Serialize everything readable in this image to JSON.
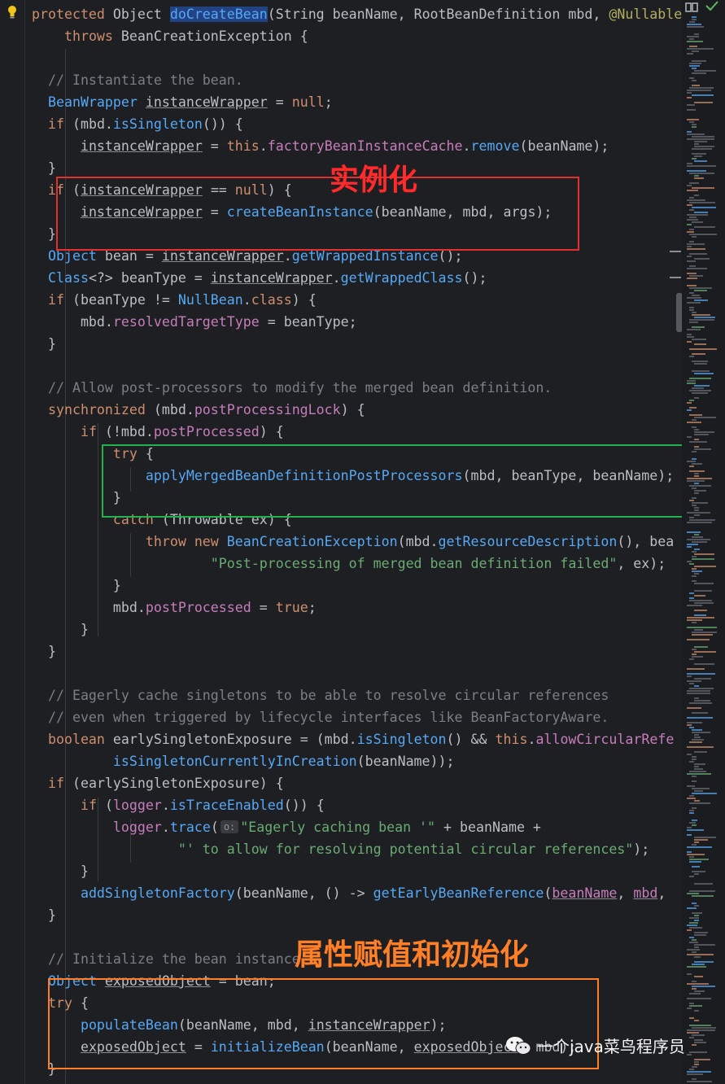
{
  "editor": {
    "lines": [
      [
        [
          "kw",
          "protected "
        ],
        [
          "ty",
          "Object "
        ],
        [
          "fn hl",
          "doCreateBean"
        ],
        [
          "ty",
          "("
        ],
        [
          "ty",
          "String beanName, "
        ],
        [
          "ty",
          "RootBeanDefinition mbd, "
        ],
        [
          "an",
          "@Nullable"
        ]
      ],
      [
        [
          "ty",
          "    "
        ],
        [
          "kw",
          "throws "
        ],
        [
          "ty",
          "BeanCreationException {"
        ]
      ],
      [],
      [
        [
          "cm",
          "  // Instantiate the bean."
        ]
      ],
      [
        [
          "ty",
          "  "
        ],
        [
          "fn",
          "BeanWrapper "
        ],
        [
          "ty u",
          "instanceWrapper"
        ],
        [
          "ty",
          " = "
        ],
        [
          "kw",
          "null"
        ],
        [
          "ty",
          ";"
        ]
      ],
      [
        [
          "ty",
          "  "
        ],
        [
          "kw",
          "if "
        ],
        [
          "ty",
          "(mbd."
        ],
        [
          "fn",
          "isSingleton"
        ],
        [
          "ty",
          "()) {"
        ]
      ],
      [
        [
          "ty",
          "      "
        ],
        [
          "ty u",
          "instanceWrapper"
        ],
        [
          "ty",
          " = "
        ],
        [
          "kw",
          "this"
        ],
        [
          "ty",
          "."
        ],
        [
          "fd",
          "factoryBeanInstanceCache"
        ],
        [
          "ty",
          "."
        ],
        [
          "fn",
          "remove"
        ],
        [
          "ty",
          "(beanName);"
        ]
      ],
      [
        [
          "ty",
          "  }"
        ]
      ],
      [
        [
          "ty",
          "  "
        ],
        [
          "kw",
          "if "
        ],
        [
          "ty",
          "("
        ],
        [
          "ty u",
          "instanceWrapper"
        ],
        [
          "ty",
          " == "
        ],
        [
          "kw",
          "null"
        ],
        [
          "ty",
          ") {"
        ]
      ],
      [
        [
          "ty",
          "      "
        ],
        [
          "ty u",
          "instanceWrapper"
        ],
        [
          "ty",
          " = "
        ],
        [
          "fn",
          "createBeanInstance"
        ],
        [
          "ty",
          "(beanName, mbd, args);"
        ]
      ],
      [
        [
          "ty",
          "  }"
        ]
      ],
      [
        [
          "ty",
          "  "
        ],
        [
          "fn",
          "Object "
        ],
        [
          "ty",
          "bean = "
        ],
        [
          "ty u",
          "instanceWrapper"
        ],
        [
          "ty",
          "."
        ],
        [
          "fn",
          "getWrappedInstance"
        ],
        [
          "ty",
          "();"
        ]
      ],
      [
        [
          "ty",
          "  "
        ],
        [
          "fn",
          "Class"
        ],
        [
          "ty",
          "<?> beanType = "
        ],
        [
          "ty u",
          "instanceWrapper"
        ],
        [
          "ty",
          "."
        ],
        [
          "fn",
          "getWrappedClass"
        ],
        [
          "ty",
          "();"
        ]
      ],
      [
        [
          "ty",
          "  "
        ],
        [
          "kw",
          "if "
        ],
        [
          "ty",
          "(beanType != "
        ],
        [
          "fn",
          "NullBean"
        ],
        [
          "ty",
          "."
        ],
        [
          "kw",
          "class"
        ],
        [
          "ty",
          ") {"
        ]
      ],
      [
        [
          "ty",
          "      mbd."
        ],
        [
          "fd",
          "resolvedTargetType"
        ],
        [
          "ty",
          " = beanType;"
        ]
      ],
      [
        [
          "ty",
          "  }"
        ]
      ],
      [],
      [
        [
          "cm",
          "  // Allow post-processors to modify the merged bean definition."
        ]
      ],
      [
        [
          "ty",
          "  "
        ],
        [
          "kw",
          "synchronized "
        ],
        [
          "ty",
          "(mbd."
        ],
        [
          "fd",
          "postProcessingLock"
        ],
        [
          "ty",
          ") {"
        ]
      ],
      [
        [
          "ty",
          "      "
        ],
        [
          "kw",
          "if "
        ],
        [
          "ty",
          "(!mbd."
        ],
        [
          "fd",
          "postProcessed"
        ],
        [
          "ty",
          ") {"
        ]
      ],
      [
        [
          "ty",
          "          "
        ],
        [
          "kw",
          "try "
        ],
        [
          "ty",
          "{"
        ]
      ],
      [
        [
          "ty",
          "              "
        ],
        [
          "fn",
          "applyMergedBeanDefinitionPostProcessors"
        ],
        [
          "ty",
          "(mbd, beanType, beanName);"
        ]
      ],
      [
        [
          "ty",
          "          }"
        ]
      ],
      [
        [
          "ty",
          "          "
        ],
        [
          "kw",
          "catch "
        ],
        [
          "ty",
          "(Throwable ex) {"
        ]
      ],
      [
        [
          "ty",
          "              "
        ],
        [
          "kw",
          "throw new "
        ],
        [
          "fn",
          "BeanCreationException"
        ],
        [
          "ty",
          "(mbd."
        ],
        [
          "fn",
          "getResourceDescription"
        ],
        [
          "ty",
          "(), bea"
        ]
      ],
      [
        [
          "ty",
          "                      "
        ],
        [
          "st",
          "\"Post-processing of merged bean definition failed\""
        ],
        [
          "ty",
          ", ex);"
        ]
      ],
      [
        [
          "ty",
          "          }"
        ]
      ],
      [
        [
          "ty",
          "          mbd."
        ],
        [
          "fd",
          "postProcessed"
        ],
        [
          "ty",
          " = "
        ],
        [
          "kw",
          "true"
        ],
        [
          "ty",
          ";"
        ]
      ],
      [
        [
          "ty",
          "      }"
        ]
      ],
      [
        [
          "ty",
          "  }"
        ]
      ],
      [],
      [
        [
          "cm",
          "  // Eagerly cache singletons to be able to resolve circular references"
        ]
      ],
      [
        [
          "cm",
          "  // even when triggered by lifecycle interfaces like BeanFactoryAware."
        ]
      ],
      [
        [
          "ty",
          "  "
        ],
        [
          "kw",
          "boolean "
        ],
        [
          "ty",
          "earlySingletonExposure = (mbd."
        ],
        [
          "fn",
          "isSingleton"
        ],
        [
          "ty",
          "() && "
        ],
        [
          "kw",
          "this"
        ],
        [
          "ty",
          "."
        ],
        [
          "fd",
          "allowCircularRefe"
        ]
      ],
      [
        [
          "ty",
          "          "
        ],
        [
          "fn",
          "isSingletonCurrentlyInCreation"
        ],
        [
          "ty",
          "(beanName));"
        ]
      ],
      [
        [
          "ty",
          "  "
        ],
        [
          "kw",
          "if "
        ],
        [
          "ty",
          "(earlySingletonExposure) {"
        ]
      ],
      [
        [
          "ty",
          "      "
        ],
        [
          "kw",
          "if "
        ],
        [
          "ty",
          "("
        ],
        [
          "fd",
          "logger"
        ],
        [
          "ty",
          "."
        ],
        [
          "fn",
          "isTraceEnabled"
        ],
        [
          "ty",
          "()) {"
        ]
      ],
      [
        [
          "ty",
          "          "
        ],
        [
          "fd",
          "logger"
        ],
        [
          "ty",
          "."
        ],
        [
          "fn",
          "trace"
        ],
        [
          "ty",
          "("
        ],
        [
          "hint",
          "o:"
        ],
        [
          "st",
          "\"Eagerly caching bean '\""
        ],
        [
          "ty",
          " + beanName +"
        ]
      ],
      [
        [
          "ty",
          "                  "
        ],
        [
          "st",
          "\"' to allow for resolving potential circular references\""
        ],
        [
          "ty",
          ");"
        ]
      ],
      [
        [
          "ty",
          "      }"
        ]
      ],
      [
        [
          "ty",
          "      "
        ],
        [
          "fn",
          "addSingletonFactory"
        ],
        [
          "ty",
          "(beanName, () -> "
        ],
        [
          "fn",
          "getEarlyBeanReference"
        ],
        [
          "ty",
          "("
        ],
        [
          "fd u",
          "beanName"
        ],
        [
          "ty",
          ", "
        ],
        [
          "fd u",
          "mbd"
        ],
        [
          "ty",
          ","
        ]
      ],
      [
        [
          "ty",
          "  }"
        ]
      ],
      [],
      [
        [
          "cm",
          "  // Initialize the bean instance."
        ]
      ],
      [
        [
          "ty",
          "  "
        ],
        [
          "fn",
          "Object "
        ],
        [
          "ty u",
          "exposedObject"
        ],
        [
          "ty",
          " = bean;"
        ]
      ],
      [
        [
          "ty",
          "  "
        ],
        [
          "kw",
          "try "
        ],
        [
          "ty",
          "{"
        ]
      ],
      [
        [
          "ty",
          "      "
        ],
        [
          "fn",
          "populateBean"
        ],
        [
          "ty",
          "(beanName, mbd, "
        ],
        [
          "ty u",
          "instanceWrapper"
        ],
        [
          "ty",
          ");"
        ]
      ],
      [
        [
          "ty",
          "      "
        ],
        [
          "ty u",
          "exposedObject"
        ],
        [
          "ty",
          " = "
        ],
        [
          "fn",
          "initializeBean"
        ],
        [
          "ty",
          "(beanName, "
        ],
        [
          "ty u",
          "exposedObject"
        ],
        [
          "ty",
          ", mbd);"
        ]
      ],
      [
        [
          "ty",
          "  }"
        ]
      ]
    ]
  },
  "annotations": {
    "instantiation": "实例化",
    "populate_init": "属性赋值和初始化"
  },
  "watermark": {
    "text": "一个java菜鸟程序员"
  },
  "colors": {
    "red_box": "#e03030",
    "green_box": "#22b14c",
    "orange_box": "#ff7f27"
  },
  "icons": [
    "lightbulb-icon",
    "reader-mode-icon",
    "check-icon",
    "wechat-icon"
  ]
}
